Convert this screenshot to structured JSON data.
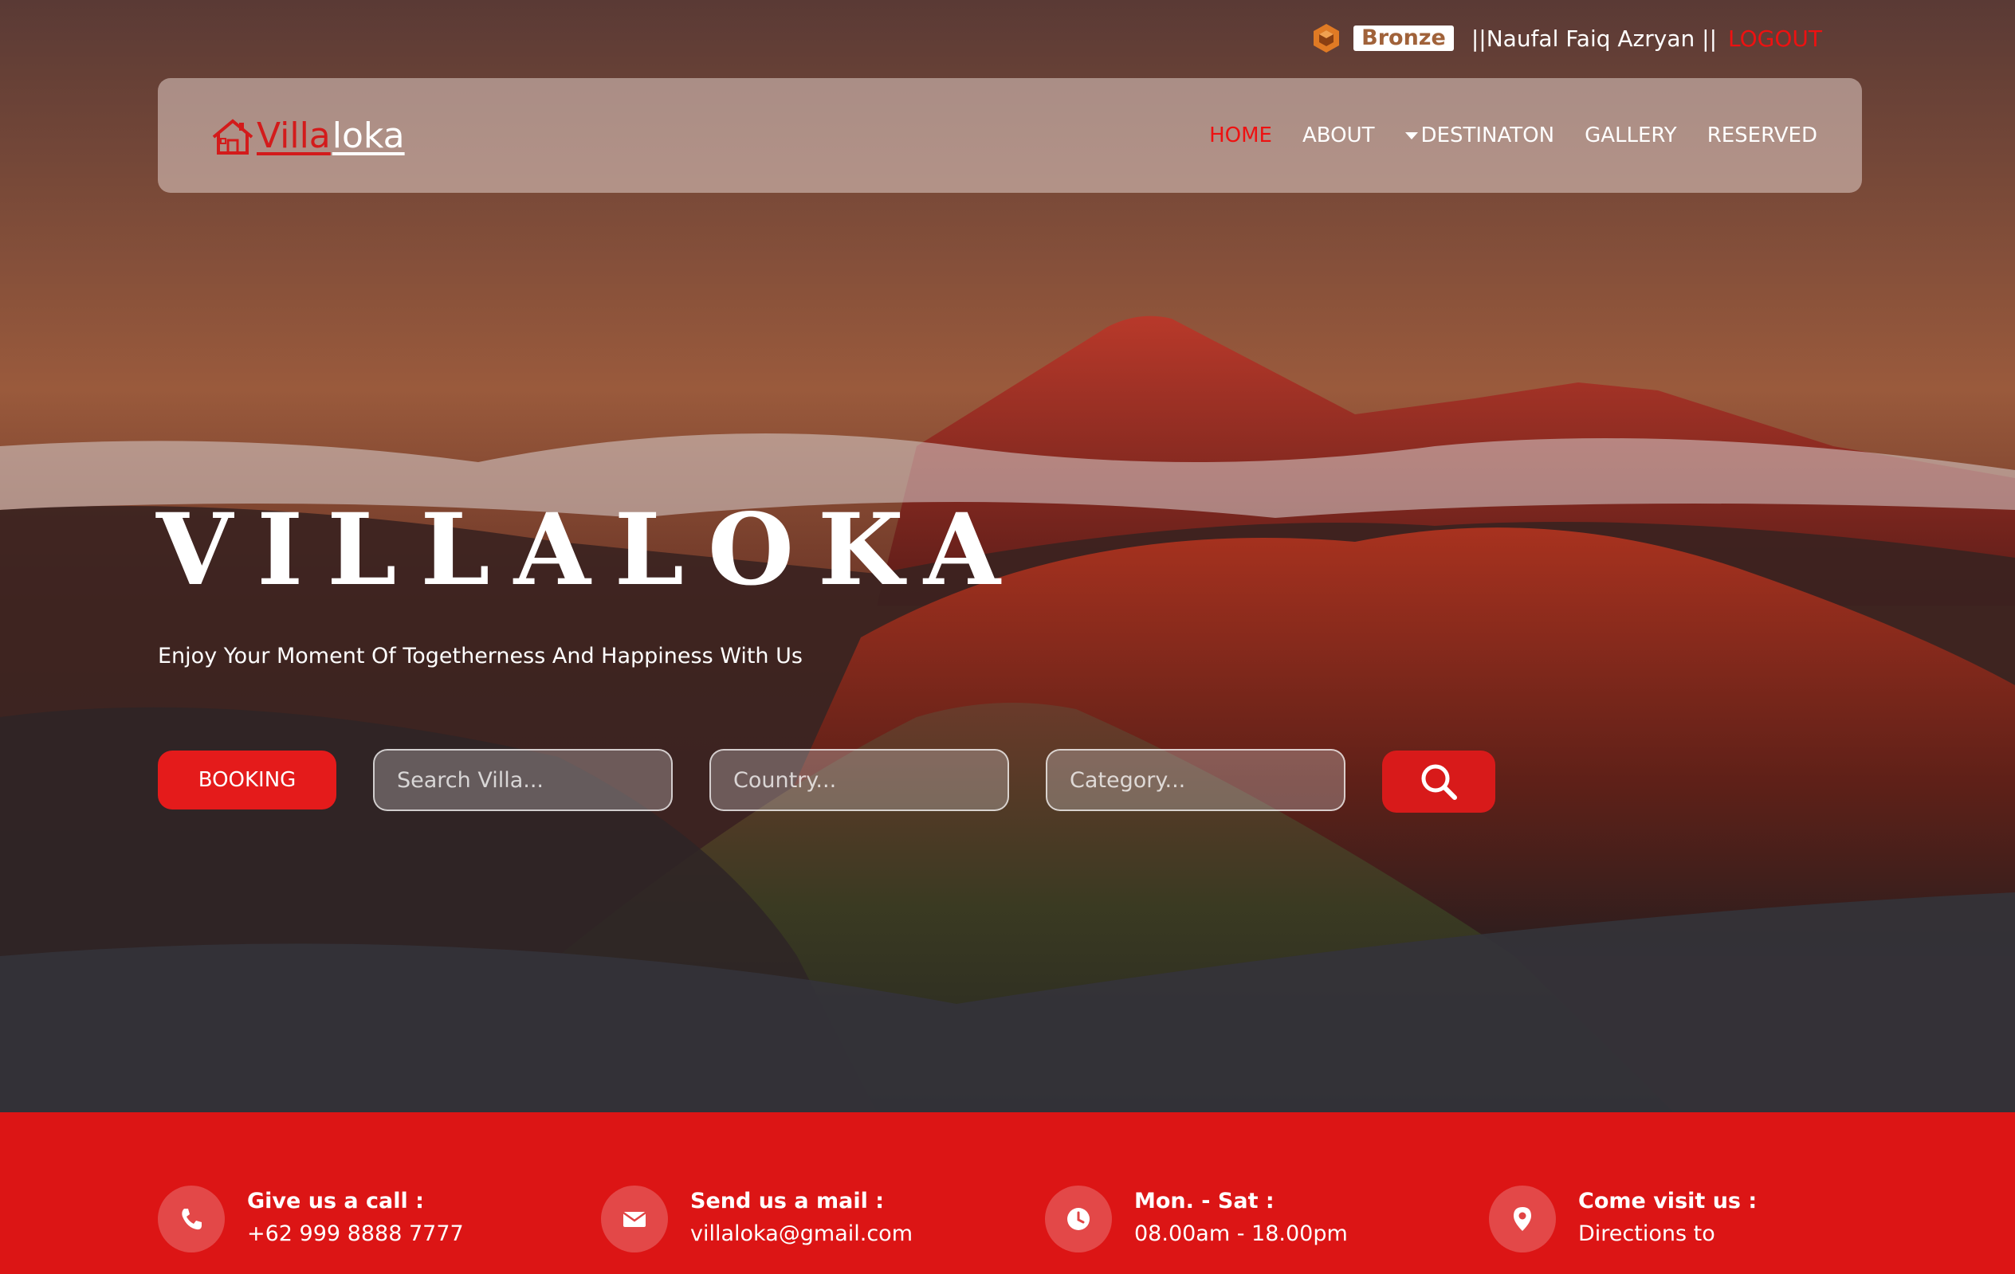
{
  "user": {
    "tier_icon": "bronze-badge-icon",
    "tier": "Bronze",
    "name_text": "||Naufal Faiq Azryan ||",
    "logout_label": "LOGOUT"
  },
  "navbar": {
    "logo_icon": "house-icon",
    "logo_part1": "Villa",
    "logo_part2": "loka",
    "links": [
      {
        "label": "HOME",
        "active": true
      },
      {
        "label": "ABOUT"
      },
      {
        "label": "DESTINATON",
        "has_dropdown": true
      },
      {
        "label": "GALLERY"
      },
      {
        "label": "RESERVED"
      }
    ]
  },
  "hero": {
    "title": "VILLALOKA",
    "subtitle": "Enjoy Your Moment Of Togetherness And Happiness With Us",
    "booking_label": "BOOKING",
    "search_placeholder": "Search Villa...",
    "country_placeholder": "Country...",
    "category_placeholder": "Category...",
    "search_icon": "search-icon"
  },
  "contacts": [
    {
      "icon": "phone-icon",
      "title": "Give us a call :",
      "value": "+62 999 8888 7777"
    },
    {
      "icon": "mail-icon",
      "title": "Send us a mail :",
      "value": "villaloka@gmail.com"
    },
    {
      "icon": "clock-icon",
      "title": "Mon. - Sat :",
      "value": "08.00am - 18.00pm"
    },
    {
      "icon": "location-pin-icon",
      "title": "Come visit us :",
      "value": "Directions to"
    }
  ],
  "colors": {
    "accent_red": "#e41b1b",
    "strip_red": "#dc1515",
    "bronze": "#a0623a"
  }
}
